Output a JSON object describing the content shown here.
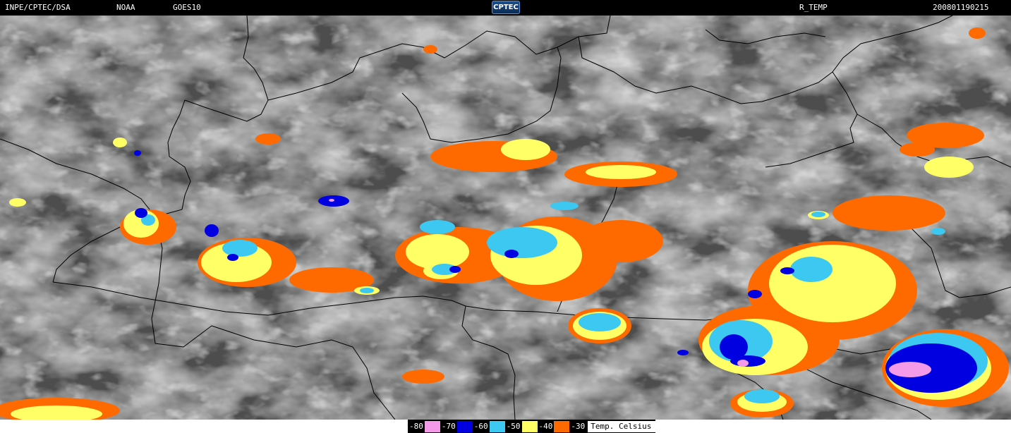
{
  "header": {
    "source": "INPE/CPTEC/DSA",
    "agency": "NOAA",
    "satellite": "GOES10",
    "logo_text": "CPTEC",
    "product": "R_TEMP",
    "timestamp": "200801190215"
  },
  "legend": {
    "items": [
      {
        "label": "-80",
        "color": "#f49ae8"
      },
      {
        "label": "-70",
        "color": "#0000e0"
      },
      {
        "label": "-60",
        "color": "#3cc8f0"
      },
      {
        "label": "-50",
        "color": "#ffff66"
      },
      {
        "label": "-40",
        "color": "#ff6a00"
      },
      {
        "label": "-30",
        "color": ""
      }
    ],
    "unit": "Temp. Celsius"
  },
  "colors": {
    "background_cloud": "#5a5a5a",
    "border_lines": "#000000"
  }
}
